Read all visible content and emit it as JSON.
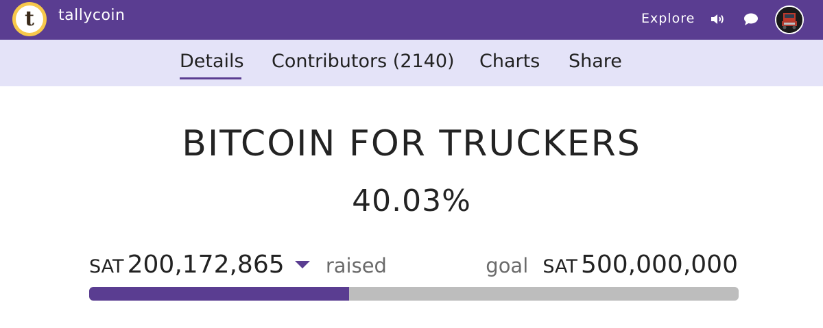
{
  "header": {
    "logo_letter": "t",
    "brand": "tallycoin",
    "explore": "Explore",
    "icons": [
      "sound-icon",
      "chat-icon"
    ]
  },
  "tabs": [
    {
      "label": "Details",
      "active": true
    },
    {
      "label": "Contributors (2140)",
      "active": false
    },
    {
      "label": "Charts",
      "active": false
    },
    {
      "label": "Share",
      "active": false
    }
  ],
  "campaign": {
    "title": "BITCOIN FOR TRUCKERS",
    "percent_label": "40.03%",
    "progress_fraction": 0.4003,
    "raised": {
      "currency": "SAT",
      "amount": "200,172,865",
      "label": "raised"
    },
    "goal": {
      "label": "goal",
      "currency": "SAT",
      "amount": "500,000,000"
    }
  },
  "colors": {
    "brand_purple": "#5a3d91",
    "tab_bar_bg": "#e4e3f8",
    "logo_gold": "#f7c84b",
    "progress_track": "#bdbdbd"
  }
}
